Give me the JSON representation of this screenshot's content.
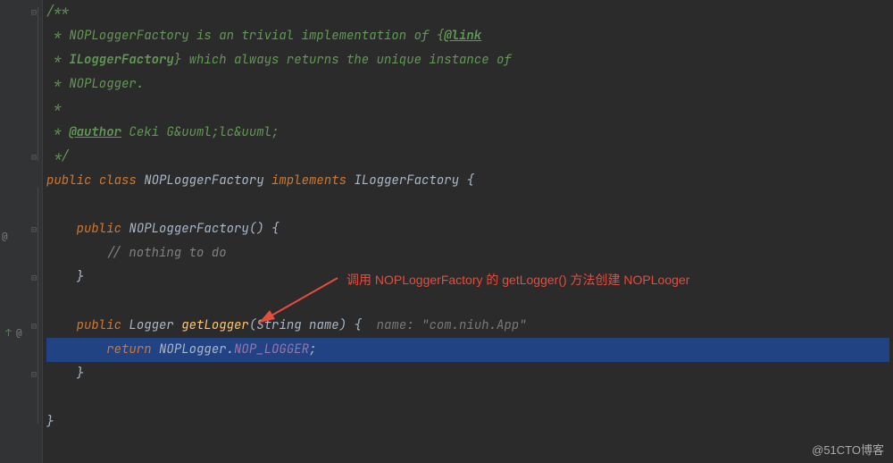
{
  "doc": {
    "open": "/**",
    "line1_pre": " * ",
    "line1_text": "NOPLoggerFactory is an trivial implementation of {",
    "line1_tag": "@link",
    "line2_pre": " * ",
    "line2_bold": "ILoggerFactory",
    "line2_text": "} which always returns the unique instance of",
    "line3": " * NOPLogger.",
    "line4": " *",
    "line5_pre": " * ",
    "line5_tag": "@author",
    "line5_text": " Ceki G&uuml;lc&uuml;",
    "close": " */"
  },
  "class": {
    "public": "public",
    "class_kw": "class",
    "name": "NOPLoggerFactory",
    "implements": "implements",
    "interface": "ILoggerFactory",
    "open": " {"
  },
  "ctor": {
    "public": "public",
    "name": "NOPLoggerFactory",
    "params": "() {",
    "comment": "// nothing to do",
    "close": "}"
  },
  "method": {
    "public": "public",
    "returnType": "Logger",
    "name": "getLogger",
    "params_open": "(String name) {",
    "hint_label": "name:",
    "hint_value": "\"com.niuh.App\"",
    "return_kw": "return",
    "return_obj": "NOPLogger.",
    "return_field": "NOP_LOGGER",
    "semi": ";",
    "close": "}"
  },
  "class_close": "}",
  "annotation": "调用 NOPLoggerFactory 的 getLogger() 方法创建 NOPLooger",
  "watermark": "@51CTO博客",
  "gutter": {
    "at1": "@",
    "at2": "@",
    "diff": "↑"
  }
}
